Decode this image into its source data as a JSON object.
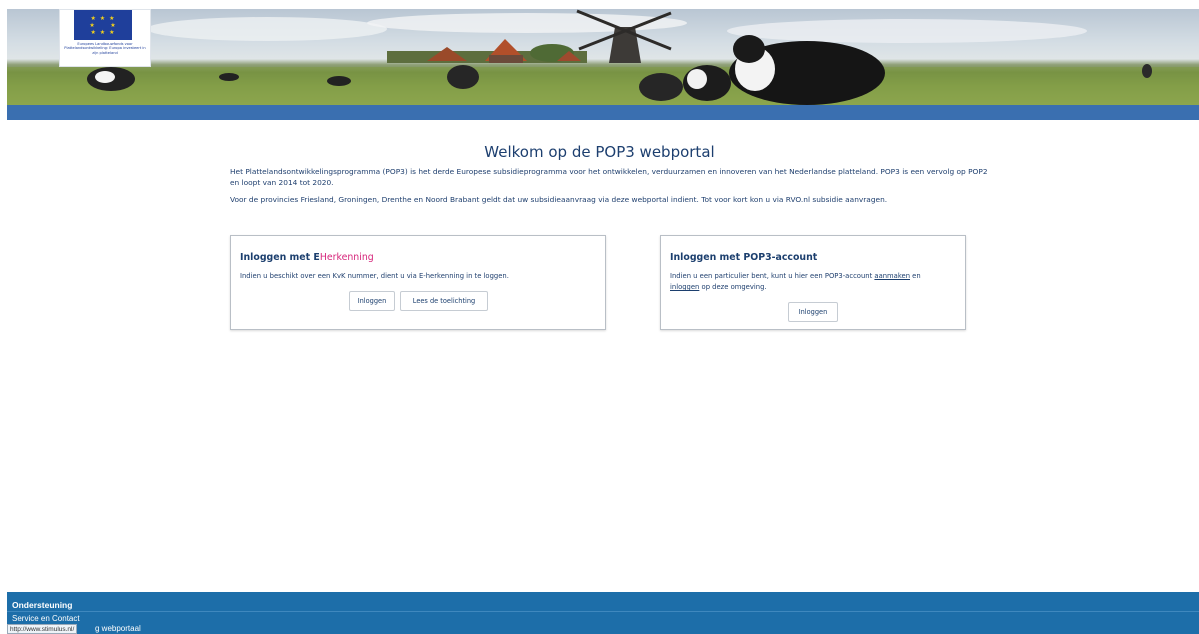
{
  "header": {
    "eu_logo_text": "Europees Landbouwfonds voor Plattelandsontwikkeling: Europa investeert in zijn platteland",
    "colors": {
      "blue_bar": "#3a6fb0",
      "eu_blue": "#1f3f9b",
      "eu_star": "#f4d21a"
    }
  },
  "main": {
    "title": "Welkom op de POP3 webportal",
    "intro_1": "Het Plattelandsontwikkelingsprogramma (POP3) is het derde Europese subsidieprogramma voor het ontwikkelen, verduurzamen en innoveren van het Nederlandse platteland. POP3 is een vervolg op POP2 en loopt van 2014 tot 2020.",
    "intro_2": "Voor de provincies Friesland, Groningen, Drenthe en Noord Brabant geldt dat uw subsidieaanvraag via deze webportal indient. Tot voor kort kon u via RVO.nl subsidie aanvragen."
  },
  "eherkenning_card": {
    "title_prefix": "Inloggen met ",
    "brand_e": "E",
    "brand_rest": "Herkenning",
    "description": "Indien u beschikt over een KvK nummer, dient u via E-herkenning in te loggen.",
    "login_button": "Inloggen",
    "info_button": "Lees de toelichting",
    "brand_color": "#d6267b"
  },
  "pop3_card": {
    "title": "Inloggen met POP3-account",
    "desc_part1": "Indien u een particulier bent, kunt u hier een POP3-account ",
    "link_create": "aanmaken",
    "desc_part2": " en",
    "link_login": "inloggen",
    "desc_part3": " op deze omgeving.",
    "login_button": "Inloggen"
  },
  "footer": {
    "title": "Ondersteuning",
    "link_contact": "Service en Contact",
    "link_webportal_visible": "g webportaal",
    "status_url": "http://www.stimulus.nl/",
    "background": "#1d6ea9"
  }
}
